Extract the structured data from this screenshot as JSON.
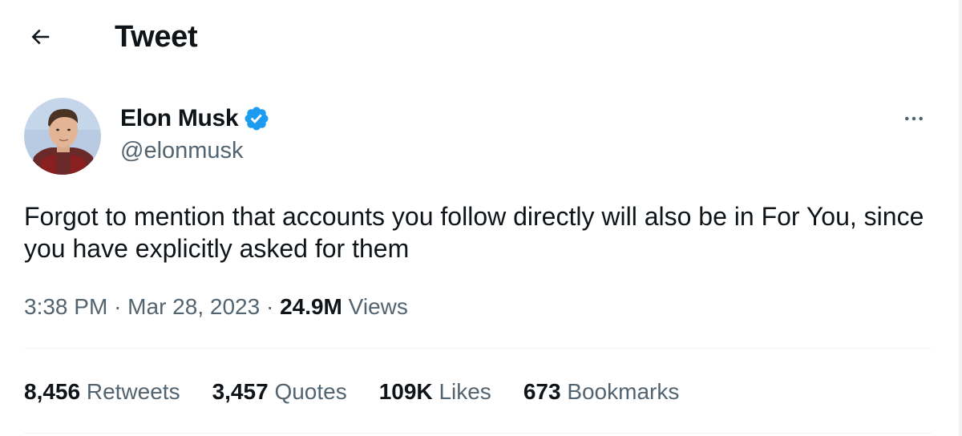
{
  "header": {
    "title": "Tweet",
    "back_icon": "arrow-left-icon"
  },
  "author": {
    "display_name": "Elon Musk",
    "handle": "@elonmusk",
    "verified_icon": "verified-badge-icon",
    "verified_color": "#1d9bf0"
  },
  "more_icon": "more-horizontal-icon",
  "tweet": {
    "text": "Forgot to mention that accounts you follow directly will also be in For You, since you have explicitly asked for them",
    "time": "3:38 PM",
    "separator": "·",
    "date": "Mar 28, 2023",
    "views_count": "24.9M",
    "views_label": "Views"
  },
  "stats": [
    {
      "count": "8,456",
      "label": "Retweets"
    },
    {
      "count": "3,457",
      "label": "Quotes"
    },
    {
      "count": "109K",
      "label": "Likes"
    },
    {
      "count": "673",
      "label": "Bookmarks"
    }
  ],
  "colors": {
    "text": "#0f1419",
    "secondary": "#536471",
    "divider": "#eff3f4"
  }
}
